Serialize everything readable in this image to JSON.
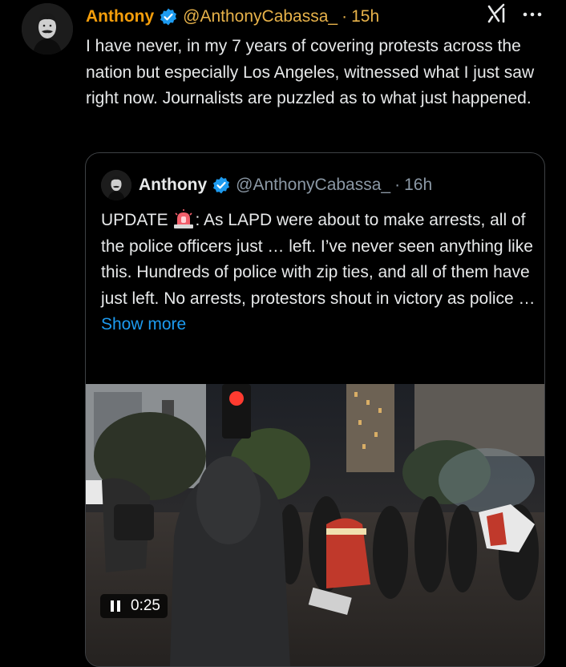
{
  "tweet": {
    "author_name": "Anthony",
    "handle": "@AnthonyCabassa_",
    "separator": "·",
    "time": "15h",
    "text": "I have never, in my 7 years of covering protests across the nation but especially Los Angeles, witnessed what I just saw right now. Journalists are puzzled as to what just happened."
  },
  "quoted": {
    "author_name": "Anthony",
    "handle": "@AnthonyCabassa_",
    "separator": "·",
    "time": "16h",
    "text_before_emoji": "UPDATE ",
    "text_after_emoji": ": As LAPD were about to make arrests, all of the police officers just … left. I’ve never seen anything like this. Hundreds of police with zip ties, and all of them have just left. No arrests, protestors shout in victory as police …",
    "show_more": "Show more",
    "video_duration": "0:25"
  },
  "colors": {
    "highlight_name": "#f59e0b",
    "verified_blue": "#1d9bf0",
    "link_blue": "#1d9bf0",
    "muted": "#8b98a5"
  },
  "icons": [
    "verified-badge-icon",
    "grok-icon",
    "more-options-icon",
    "siren-emoji-icon",
    "pause-icon"
  ]
}
